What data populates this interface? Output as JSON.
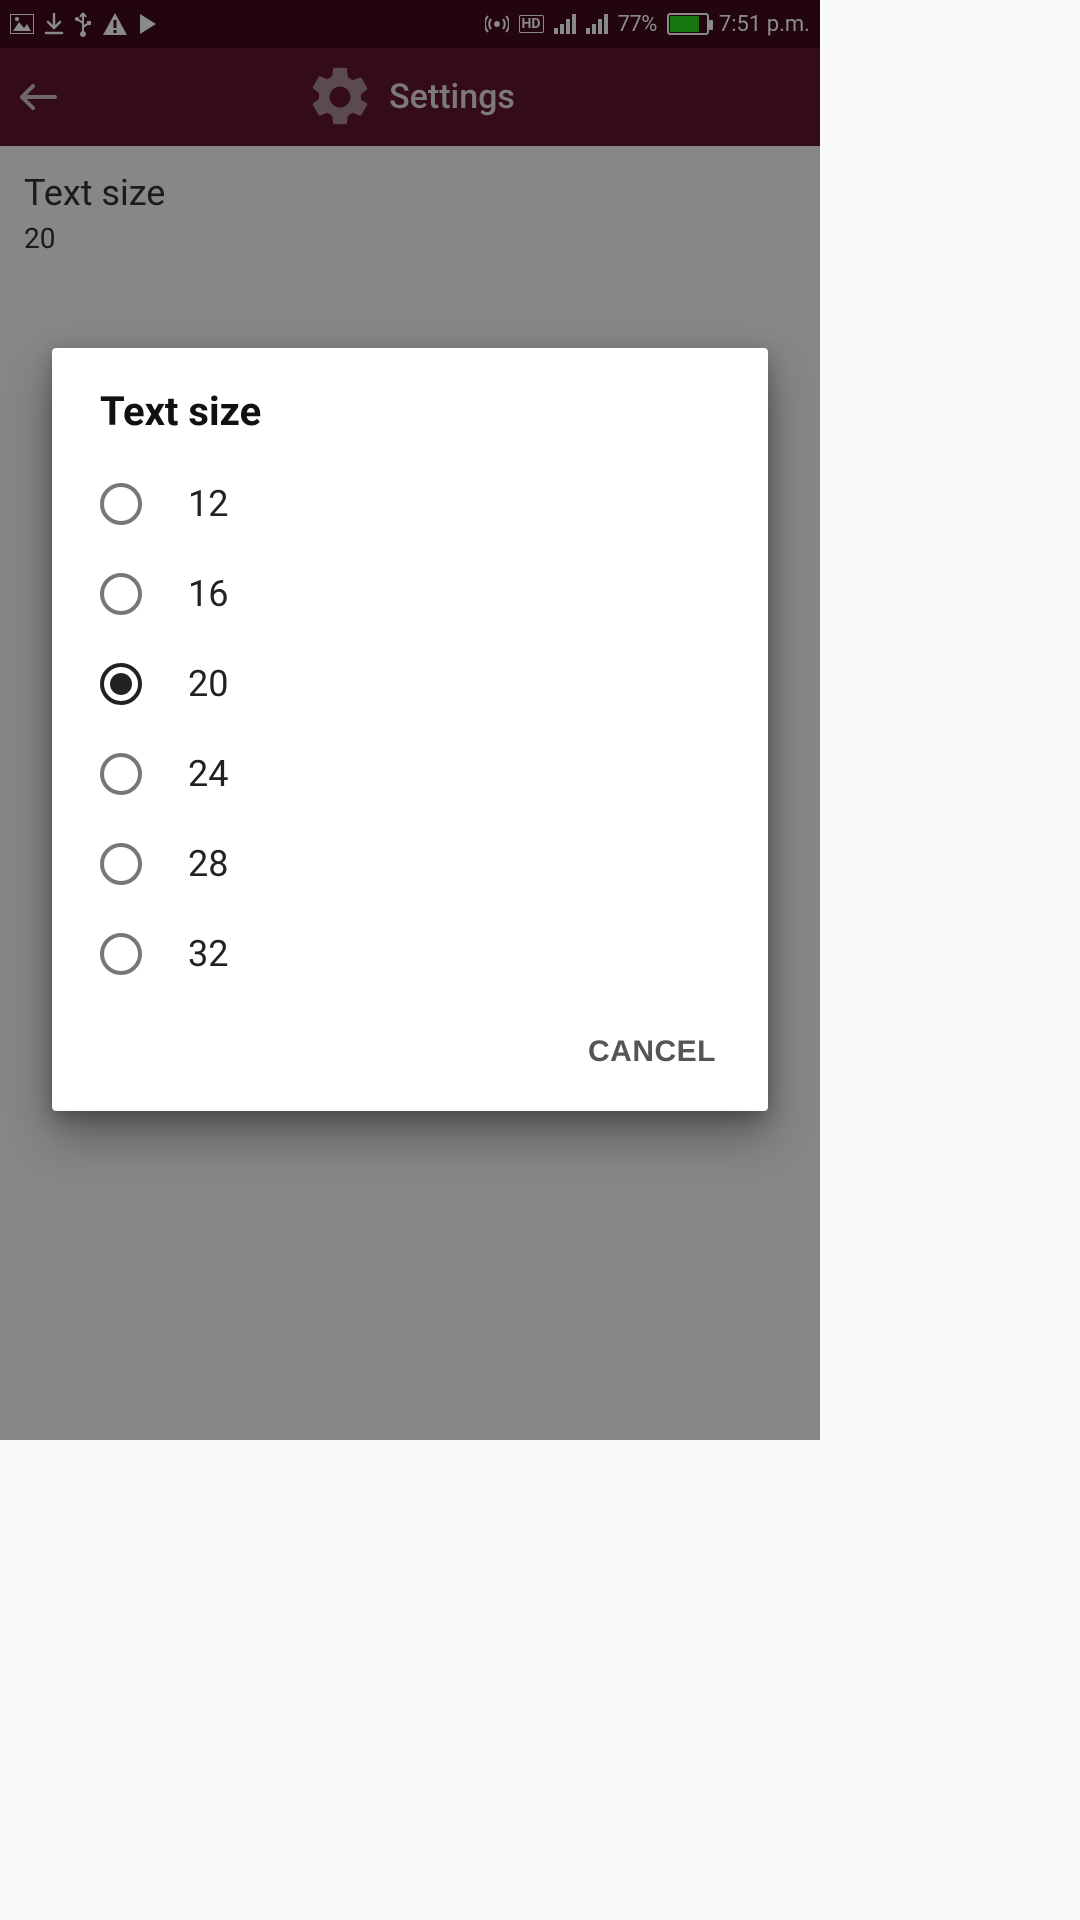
{
  "status": {
    "battery_pct": "77%",
    "time": "7:51 p.m."
  },
  "appbar": {
    "title": "Settings"
  },
  "pref": {
    "title": "Text size",
    "value": "20"
  },
  "dialog": {
    "title": "Text size",
    "cancel": "CANCEL",
    "selected_index": 2,
    "options": [
      {
        "label": "12"
      },
      {
        "label": "16"
      },
      {
        "label": "20"
      },
      {
        "label": "24"
      },
      {
        "label": "28"
      },
      {
        "label": "32"
      }
    ]
  }
}
